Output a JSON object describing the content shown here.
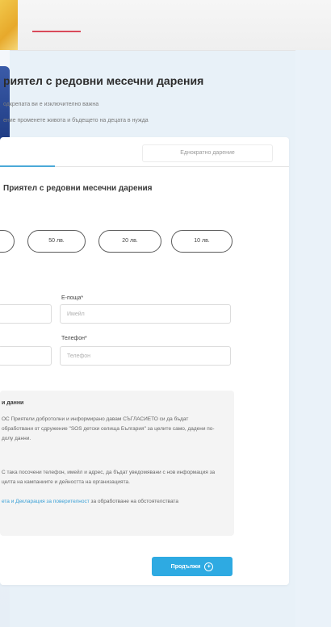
{
  "page": {
    "title": "риятел с редовни месечни дарения",
    "subtitle_1": "одкрепата ви е изключително важна",
    "subtitle_2": "ение променете живота и бъдещето на децата в нужда"
  },
  "tabs": {
    "active": "",
    "inactive": "Еднократно дарение"
  },
  "form": {
    "section_title": "Приятел с редовни месечни дарения",
    "amounts": [
      "",
      "50 лв.",
      "20 лв.",
      "10 лв."
    ],
    "fields": {
      "email_label": "Е-поща*",
      "email_placeholder": "Имейл",
      "phone_label": "Телефон*",
      "phone_placeholder": "Телефон"
    },
    "left_inputs": [
      "",
      ""
    ]
  },
  "gdpr": {
    "title": "и данни",
    "text_1": "ОС Приятели добротолни и информирано давам СЪГЛАСИЕТО си да бъдат обработвани от сдружение \"SOS детски селища България\" за целите само, дадени по-долу данни.",
    "text_2": "С така посочени телефон, имейл и адрес, да бъдат уведомявани с нов информация за целта на кампаниите и дейността на организацията.",
    "link_text": "ета и Декларация за поверителност",
    "link_suffix": " за обработване на обстоятелствата"
  },
  "submit": {
    "label": "Продължи"
  },
  "colors": {
    "accent": "#2eaae2",
    "tab_indicator": "#4ba9d8",
    "nav_active": "#d94a5a",
    "background": "#e8f1f8"
  }
}
